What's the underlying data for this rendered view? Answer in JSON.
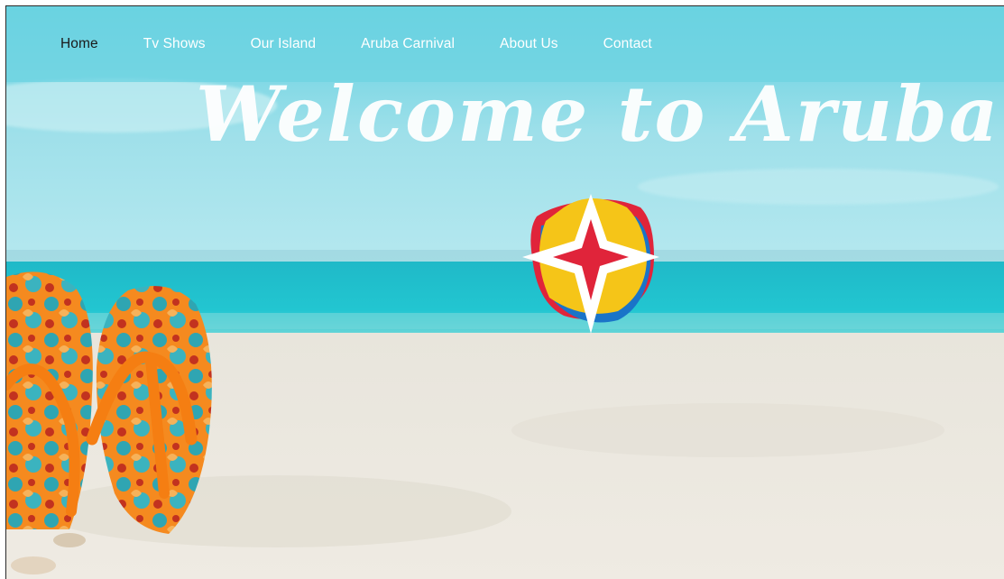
{
  "nav": {
    "items": [
      {
        "label": "Home",
        "active": true
      },
      {
        "label": "Tv Shows",
        "active": false
      },
      {
        "label": "Our Island",
        "active": false
      },
      {
        "label": "Aruba Carnival",
        "active": false
      },
      {
        "label": "About Us",
        "active": false
      },
      {
        "label": "Contact",
        "active": false
      }
    ]
  },
  "hero": {
    "heading": "Welcome to Aruba.Tv",
    "logo": "aruba-star-logo"
  },
  "colors": {
    "nav_bg": "#6ed4e2",
    "sky": "#8fdbe6",
    "sea": "#21c3cf",
    "sand": "#ece8df",
    "logo_yellow": "#f5c518",
    "logo_red": "#e0243a",
    "logo_blue": "#1a74c8",
    "flipflop_orange": "#f58a1f",
    "flipflop_teal": "#2fa5b2"
  }
}
